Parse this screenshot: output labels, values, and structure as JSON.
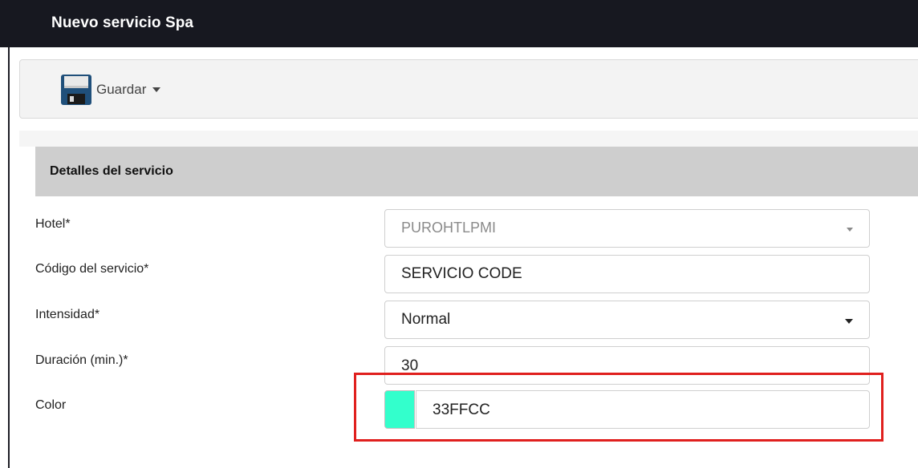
{
  "window": {
    "title": "Nuevo servicio Spa"
  },
  "toolbar": {
    "save_icon": "floppy-disk-icon",
    "save_label": "Guardar"
  },
  "section": {
    "title": "Detalles del servicio"
  },
  "form": {
    "hotel": {
      "label": "Hotel*",
      "value": "PUROHTLPMI"
    },
    "codigo": {
      "label": "Código del servicio*",
      "value": "SERVICIO CODE"
    },
    "intensidad": {
      "label": "Intensidad*",
      "value": "Normal"
    },
    "duracion": {
      "label": "Duración (min.)*",
      "value": "30"
    },
    "color": {
      "label": "Color",
      "value": "33FFCC",
      "swatch_color": "#33FFCC"
    }
  },
  "colors": {
    "titlebar_bg": "#171820",
    "highlight_border": "#e0201e",
    "section_header_bg": "#cecece"
  }
}
